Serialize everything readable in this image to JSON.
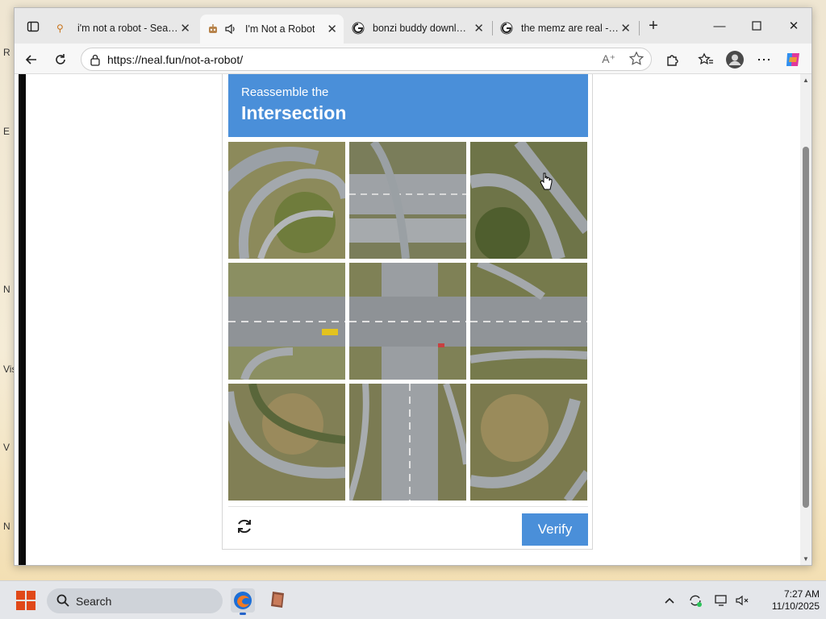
{
  "desktop": {
    "labels": [
      "R",
      "E",
      "N",
      "Vis",
      "V",
      "N"
    ]
  },
  "tabs": [
    {
      "title": "i'm not a robot - Search",
      "icon": "search-favicon",
      "active": false
    },
    {
      "title": "I'm Not a Robot",
      "icon": "robot-favicon",
      "active": true
    },
    {
      "title": "bonzi buddy download",
      "icon": "google-favicon",
      "active": false
    },
    {
      "title": "the memz are real - Go",
      "icon": "google-favicon",
      "active": false
    }
  ],
  "toolbar": {
    "url": "https://neal.fun/not-a-robot/"
  },
  "captcha": {
    "prefix": "Reassemble the",
    "title": "Intersection",
    "verify_label": "Verify",
    "header_color": "#4a8fd9"
  },
  "taskbar": {
    "search_label": "Search",
    "time": "7:27 AM",
    "date": "11/10/2025"
  }
}
